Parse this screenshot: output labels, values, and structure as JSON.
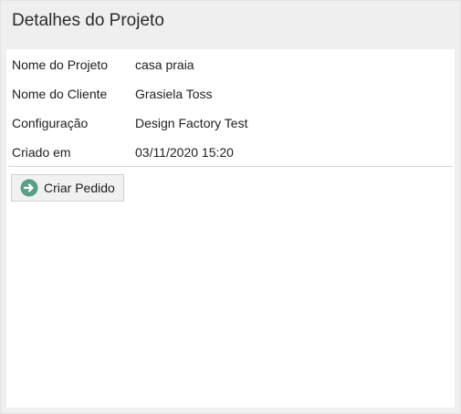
{
  "panel": {
    "title": "Detalhes do Projeto"
  },
  "details": [
    {
      "label": "Nome do Projeto",
      "value": "casa praia"
    },
    {
      "label": "Nome do Cliente",
      "value": "Grasiela Toss"
    },
    {
      "label": "Configuração",
      "value": "Design Factory Test"
    },
    {
      "label": "Criado em",
      "value": "03/11/2020 15:20"
    }
  ],
  "actions": {
    "create_order": {
      "label": "Criar Pedido",
      "icon": "arrow-right-circle-icon",
      "icon_color": "#5a9e86"
    }
  }
}
